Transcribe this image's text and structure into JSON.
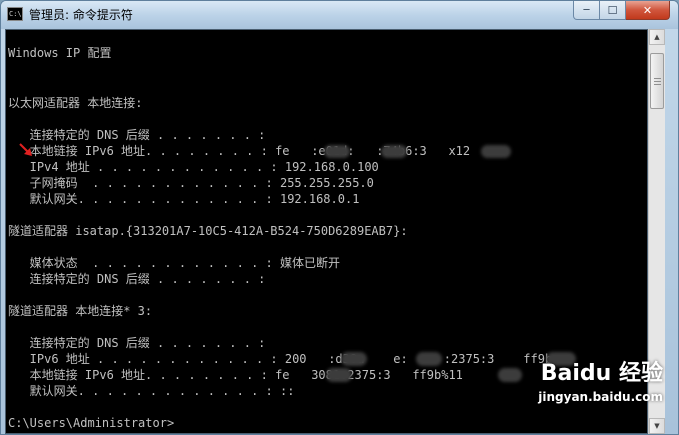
{
  "window": {
    "title": "管理员: 命令提示符",
    "icon_text": "C:\\",
    "min_glyph": "─",
    "max_glyph": "☐",
    "close_glyph": "✕"
  },
  "console": {
    "lines": [
      "Windows IP 配置",
      "以太网适配器 本地连接:",
      "   连接特定的 DNS 后缀 . . . . . . . :",
      "   本地链接 IPv6 地址. . . . . . . . : fe   :e01d:   :74b6:3   x12",
      "   IPv4 地址 . . . . . . . . . . . . : 192.168.0.100",
      "   子网掩码  . . . . . . . . . . . . : 255.255.255.0",
      "   默认网关. . . . . . . . . . . . . : 192.168.0.1",
      "隧道适配器 isatap.{313201A7-10C5-412A-B524-750D6289EAB7}:",
      "   媒体状态  . . . . . . . . . . . . : 媒体已断开",
      "   连接特定的 DNS 后缀 . . . . . . . :",
      "隧道适配器 本地连接* 3:",
      "   连接特定的 DNS 后缀 . . . . . . . :",
      "   IPv6 地址 . . . . . . . . . . . . : 200   :d38a    e:     :2375:3    ff9b",
      "   本地链接 IPv6 地址. . . . . . . . : fe   3081:2375:3   ff9b%11",
      "   默认网关. . . . . . . . . . . . . : ::",
      "C:\\Users\\Administrator>"
    ]
  },
  "scrollbar": {
    "up_glyph": "▲",
    "down_glyph": "▼",
    "position": 0.06
  },
  "watermark": {
    "brand": "Baidu 经验",
    "url": "jingyan.baidu.com"
  }
}
